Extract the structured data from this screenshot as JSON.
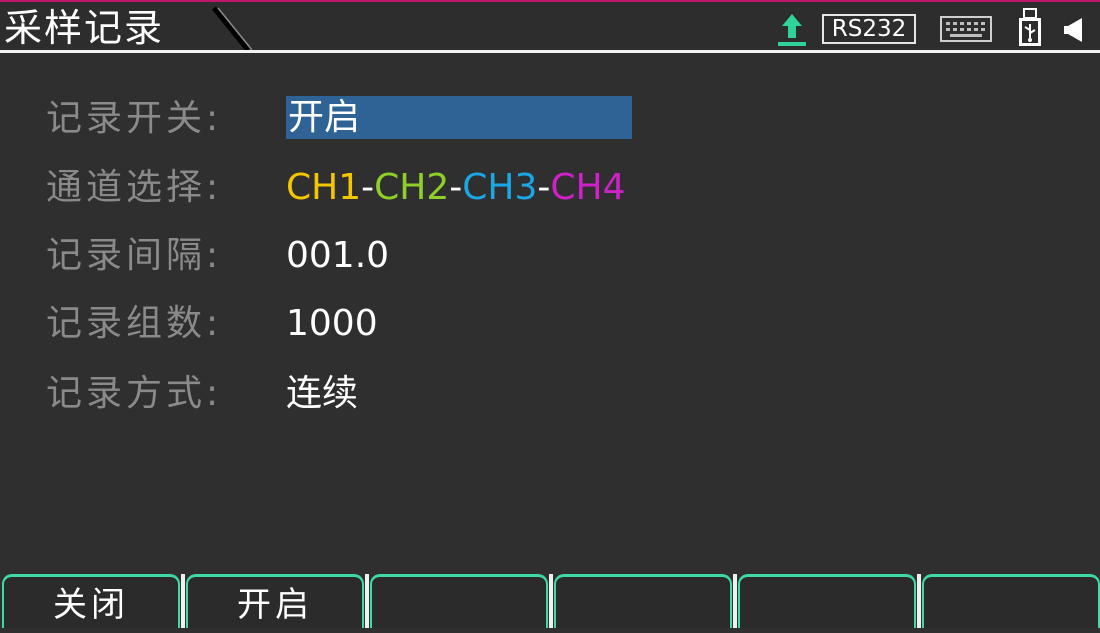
{
  "header": {
    "title": "采样记录",
    "status": {
      "rs232_label": "RS232",
      "icons": [
        "upload-icon",
        "keyboard-icon",
        "usb-icon",
        "speaker-icon"
      ]
    }
  },
  "form": {
    "rows": [
      {
        "label": "记录开关:",
        "value": "开启"
      },
      {
        "label": "通道选择:",
        "channels": [
          "CH1",
          "CH2",
          "CH3",
          "CH4"
        ],
        "separator": "-"
      },
      {
        "label": "记录间隔:",
        "value": "001.0"
      },
      {
        "label": "记录组数:",
        "value": "1000"
      },
      {
        "label": "记录方式:",
        "value": "连续"
      }
    ]
  },
  "softkeys": {
    "keys": [
      {
        "label": "关闭"
      },
      {
        "label": "开启"
      },
      {
        "label": ""
      },
      {
        "label": ""
      },
      {
        "label": ""
      },
      {
        "label": ""
      }
    ]
  },
  "colors": {
    "accent_teal": "#3fd9a7",
    "selection_blue": "#2f6295",
    "ch1": "#f4c600",
    "ch2": "#8fcf2a",
    "ch3": "#1ba7e6",
    "ch4": "#d020c9",
    "top_strip": "#c0166e"
  }
}
